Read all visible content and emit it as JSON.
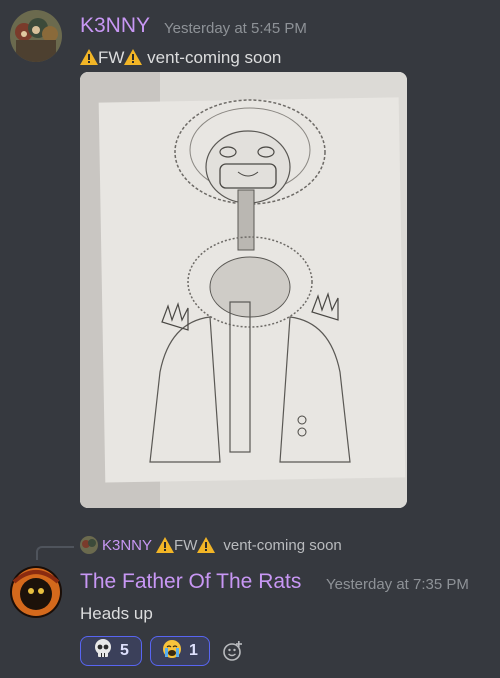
{
  "message1": {
    "username": "K3NNY",
    "timestamp": "Yesterday at 5:45 PM",
    "text_fw": "FW",
    "text_rest": "vent-coming soon",
    "attachment_icon": "sketch-image"
  },
  "reply": {
    "ref_username": "K3NNY",
    "ref_fw": "FW",
    "ref_rest": "vent-coming soon"
  },
  "message2": {
    "username": "The Father Of The Rats",
    "timestamp": "Yesterday at 7:35 PM",
    "text": "Heads up"
  },
  "reactions": [
    {
      "emoji": "skull",
      "count": "5"
    },
    {
      "emoji": "crying-face",
      "count": "1"
    }
  ],
  "colors": {
    "background": "#36393f",
    "username": "#c897f4",
    "timestamp": "#8e9297",
    "reaction_border": "#5865f2",
    "reaction_bg": "#3b405a"
  }
}
